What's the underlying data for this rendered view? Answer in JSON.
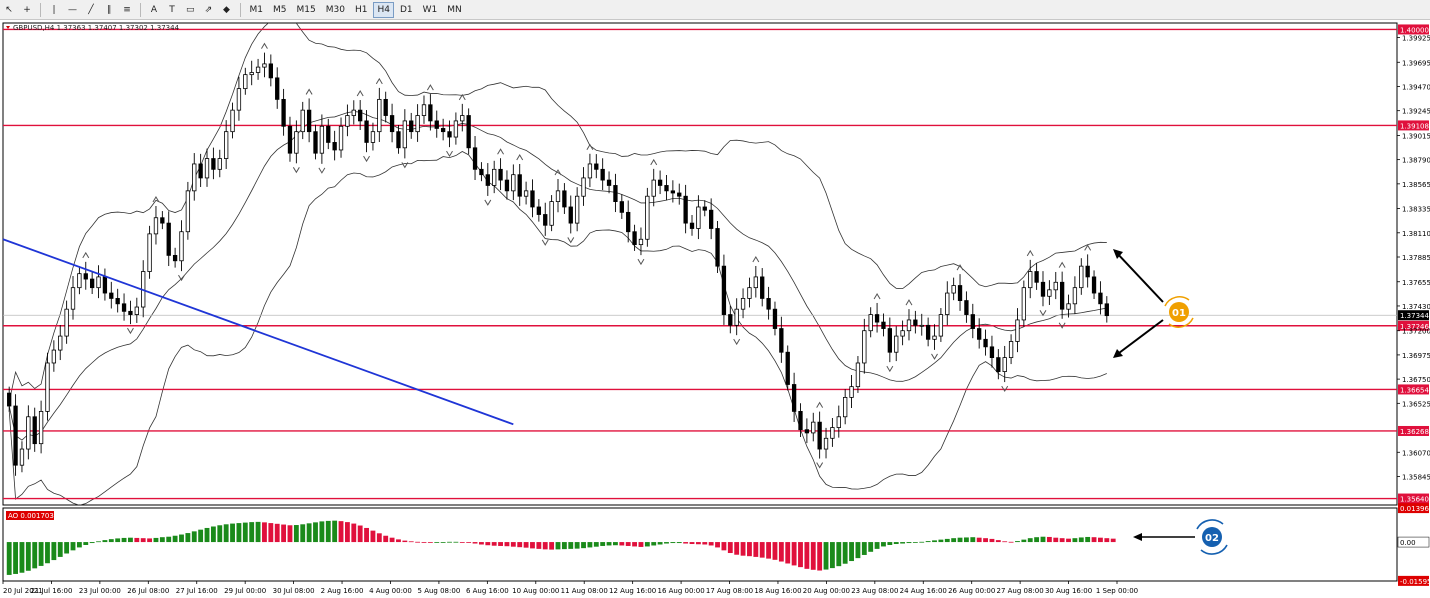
{
  "toolbar": {
    "tools": [
      "cursor-icon",
      "crosshair-icon",
      "vertical-line-icon",
      "horizontal-line-icon",
      "trendline-icon",
      "channel-icon",
      "fibonacci-icon",
      "text-icon",
      "label-icon",
      "rectangle-icon",
      "arrow-icon",
      "shapes-icon"
    ],
    "text_tool": "A",
    "label_tool": "T",
    "timeframes": [
      "M1",
      "M5",
      "M15",
      "M30",
      "H1",
      "H4",
      "D1",
      "W1",
      "MN"
    ],
    "active_timeframe": "H4"
  },
  "chart_data": {
    "type": "candlestick",
    "title": "GBPUSD,H4  1.37363 1.37407 1.37302 1.37344",
    "price_ticks": [
      "1.39925",
      "1.39695",
      "1.39470",
      "1.39245",
      "1.39015",
      "1.38790",
      "1.38565",
      "1.38335",
      "1.38110",
      "1.37885",
      "1.37655",
      "1.37430",
      "1.37200",
      "1.36975",
      "1.36750",
      "1.36525",
      "1.36070",
      "1.35845"
    ],
    "ylim": [
      1.3558,
      1.4006
    ],
    "horizontal_levels": [
      {
        "price": 1.4,
        "label": "1.40000"
      },
      {
        "price": 1.39108,
        "label": "1.39108"
      },
      {
        "price": 1.37246,
        "label": "1.37246"
      },
      {
        "price": 1.36654,
        "label": "1.36654"
      },
      {
        "price": 1.36268,
        "label": "1.36268"
      },
      {
        "price": 1.3564,
        "label": "1.35640"
      }
    ],
    "current_price": {
      "price": 1.37344,
      "label": "1.37344"
    },
    "level_color": "#e0103c",
    "trendline_color": "#1f35d6",
    "trendline": {
      "from": {
        "bar": 0,
        "price": 1.3805
      },
      "to": {
        "bar": 79,
        "price": 1.3633
      }
    },
    "time_labels": [
      "20 Jul 2021",
      "21 Jul 16:00",
      "23 Jul 00:00",
      "26 Jul 08:00",
      "27 Jul 16:00",
      "29 Jul 00:00",
      "30 Jul 08:00",
      "2 Aug 16:00",
      "4 Aug 00:00",
      "5 Aug 08:00",
      "6 Aug 16:00",
      "10 Aug 00:00",
      "11 Aug 08:00",
      "12 Aug 16:00",
      "16 Aug 00:00",
      "17 Aug 08:00",
      "18 Aug 16:00",
      "20 Aug 00:00",
      "23 Aug 08:00",
      "24 Aug 16:00",
      "26 Aug 00:00",
      "27 Aug 08:00",
      "30 Aug 16:00",
      "1 Sep 00:00"
    ],
    "closes": [
      1.365,
      1.3595,
      1.361,
      1.364,
      1.3615,
      1.3645,
      1.369,
      1.3702,
      1.3715,
      1.374,
      1.376,
      1.3773,
      1.3768,
      1.376,
      1.377,
      1.3755,
      1.375,
      1.3745,
      1.3738,
      1.3735,
      1.3742,
      1.3775,
      1.381,
      1.3825,
      1.382,
      1.379,
      1.3785,
      1.3812,
      1.385,
      1.3875,
      1.3862,
      1.388,
      1.387,
      1.388,
      1.3905,
      1.3925,
      1.3945,
      1.3958,
      1.396,
      1.3965,
      1.3968,
      1.3955,
      1.3935,
      1.391,
      1.3885,
      1.3905,
      1.3925,
      1.3905,
      1.3885,
      1.391,
      1.3895,
      1.3888,
      1.391,
      1.392,
      1.3925,
      1.3915,
      1.3895,
      1.3905,
      1.3935,
      1.392,
      1.3905,
      1.389,
      1.3915,
      1.3905,
      1.392,
      1.393,
      1.3915,
      1.3908,
      1.3905,
      1.39,
      1.3915,
      1.392,
      1.389,
      1.387,
      1.3865,
      1.3855,
      1.387,
      1.386,
      1.385,
      1.3865,
      1.3845,
      1.385,
      1.3835,
      1.3828,
      1.3818,
      1.384,
      1.385,
      1.3835,
      1.382,
      1.3845,
      1.3862,
      1.3875,
      1.387,
      1.386,
      1.3855,
      1.384,
      1.383,
      1.3812,
      1.38,
      1.3805,
      1.3845,
      1.386,
      1.3855,
      1.385,
      1.3848,
      1.3845,
      1.382,
      1.3815,
      1.3835,
      1.3832,
      1.3815,
      1.378,
      1.3735,
      1.3725,
      1.374,
      1.375,
      1.376,
      1.377,
      1.375,
      1.374,
      1.3722,
      1.37,
      1.367,
      1.3645,
      1.3628,
      1.3625,
      1.3635,
      1.361,
      1.362,
      1.363,
      1.364,
      1.3658,
      1.3668,
      1.369,
      1.372,
      1.3735,
      1.3728,
      1.3722,
      1.37,
      1.3715,
      1.372,
      1.373,
      1.3725,
      1.3725,
      1.3712,
      1.3715,
      1.3735,
      1.3755,
      1.3762,
      1.3748,
      1.3735,
      1.3722,
      1.3712,
      1.3705,
      1.3695,
      1.3682,
      1.3695,
      1.371,
      1.373,
      1.376,
      1.3775,
      1.3765,
      1.3752,
      1.3758,
      1.3765,
      1.374,
      1.3745,
      1.376,
      1.378,
      1.377,
      1.3755,
      1.3745,
      1.3734
    ],
    "annotations": [
      {
        "label": "01",
        "color": "#f0a000"
      },
      {
        "label": "02",
        "color": "#1560b0"
      }
    ],
    "indicator": {
      "name": "AO 0.001703",
      "ticks": [
        "0.013963",
        "0.00",
        "-0.015952"
      ],
      "ylim": [
        -0.016,
        0.014
      ],
      "up_color": "#1a8a1a",
      "down_color": "#e0103c",
      "values": [
        -0.0135,
        -0.0131,
        -0.0126,
        -0.0118,
        -0.0108,
        -0.0098,
        -0.0087,
        -0.0074,
        -0.0061,
        -0.0047,
        -0.0034,
        -0.0022,
        -0.0012,
        -0.0004,
        0.0003,
        0.0008,
        0.0012,
        0.0015,
        0.0017,
        0.0018,
        0.0017,
        0.0016,
        0.0015,
        0.0017,
        0.002,
        0.0022,
        0.0026,
        0.0031,
        0.0037,
        0.0044,
        0.0051,
        0.0058,
        0.0064,
        0.0069,
        0.0073,
        0.0076,
        0.0078,
        0.008,
        0.0082,
        0.0083,
        0.0081,
        0.0078,
        0.0075,
        0.0072,
        0.0069,
        0.007,
        0.0073,
        0.0077,
        0.0081,
        0.0085,
        0.0087,
        0.0088,
        0.0086,
        0.0082,
        0.0076,
        0.0068,
        0.0058,
        0.0047,
        0.0036,
        0.0026,
        0.0018,
        0.0011,
        0.0006,
        0.0003,
        0.0001,
        0.0,
        -0.0001,
        -0.0001,
        0.0,
        0.0001,
        0.0001,
        0.0,
        -0.0003,
        -0.0006,
        -0.001,
        -0.0013,
        -0.0015,
        -0.0016,
        -0.0017,
        -0.0019,
        -0.0021,
        -0.0023,
        -0.0026,
        -0.0028,
        -0.003,
        -0.0031,
        -0.003,
        -0.0029,
        -0.0028,
        -0.0027,
        -0.0025,
        -0.0022,
        -0.0019,
        -0.0016,
        -0.0014,
        -0.0013,
        -0.0014,
        -0.0016,
        -0.0018,
        -0.002,
        -0.0018,
        -0.0014,
        -0.001,
        -0.0006,
        -0.0004,
        -0.0004,
        -0.0006,
        -0.0008,
        -0.0009,
        -0.001,
        -0.0014,
        -0.0022,
        -0.0034,
        -0.0045,
        -0.0052,
        -0.0056,
        -0.0058,
        -0.0061,
        -0.0064,
        -0.0068,
        -0.0073,
        -0.008,
        -0.0088,
        -0.0096,
        -0.0103,
        -0.011,
        -0.0114,
        -0.0117,
        -0.0113,
        -0.0107,
        -0.0099,
        -0.0089,
        -0.0078,
        -0.0066,
        -0.0053,
        -0.004,
        -0.0028,
        -0.0018,
        -0.0012,
        -0.0008,
        -0.0006,
        -0.0004,
        -0.0002,
        0.0001,
        0.0004,
        0.0007,
        0.001,
        0.0013,
        0.0016,
        0.0018,
        0.0019,
        0.002,
        0.0018,
        0.0016,
        0.0013,
        0.0008,
        0.0003,
        0.0001,
        0.0004,
        0.001,
        0.0016,
        0.002,
        0.0022,
        0.0021,
        0.0018,
        0.0016,
        0.0014,
        0.0016,
        0.0019,
        0.0021,
        0.002,
        0.0018,
        0.0016,
        0.0014
      ]
    }
  }
}
